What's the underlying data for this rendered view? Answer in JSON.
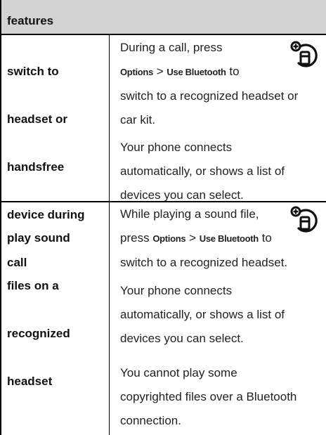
{
  "header": {
    "label": "features"
  },
  "rows": [
    {
      "feature_lines": [
        "switch to",
        "headset or",
        "handsfree",
        "device during",
        "call"
      ],
      "instruction": {
        "line1": "During a call, press",
        "key1": "Options",
        "sep": ">",
        "key2": "Use Bluetooth",
        "tail": "to",
        "line3": "switch to a recognized headset or",
        "line4": "car kit."
      },
      "para2": [
        "Your phone connects",
        "automatically, or shows a list of",
        "devices you can select."
      ],
      "icon": "bluetooth-handsfree-icon"
    },
    {
      "feature_lines": [
        "play sound",
        "files on a",
        "recognized",
        "headset"
      ],
      "instruction": {
        "line1": "While playing a sound file,",
        "pre": "press",
        "key1": "Options",
        "sep": ">",
        "key2": "Use Bluetooth",
        "tail": "to",
        "line3": "switch to a recognized headset."
      },
      "para2": [
        "Your phone connects",
        "automatically, or shows a list of",
        "devices you can select."
      ],
      "para3": [
        "You cannot play some",
        "copyrighted files over a Bluetooth",
        "connection."
      ],
      "icon": "bluetooth-handsfree-icon"
    }
  ]
}
